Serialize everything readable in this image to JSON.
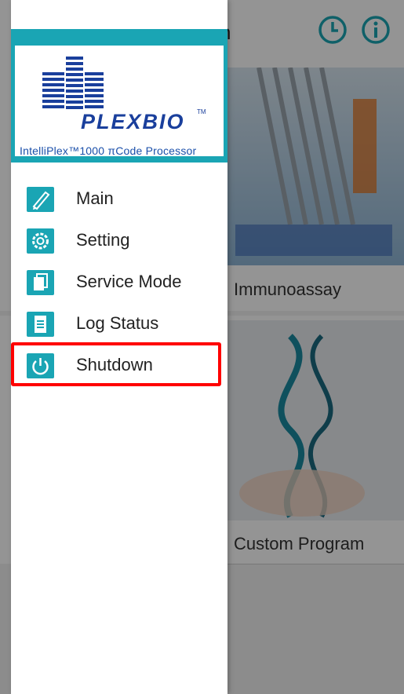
{
  "app": {
    "title": "n",
    "cards": [
      {
        "label": "Immunoassay"
      },
      {
        "label": "Custom Program"
      }
    ]
  },
  "drawer": {
    "logo": {
      "brand": "PLEXBIO",
      "tm": "TM",
      "subtitle": "IntelliPlex™1000 πCode Processor"
    },
    "items": [
      {
        "label": "Main",
        "icon": "pen-icon"
      },
      {
        "label": "Setting",
        "icon": "gear-icon"
      },
      {
        "label": "Service Mode",
        "icon": "copy-icon"
      },
      {
        "label": "Log Status",
        "icon": "document-icon"
      },
      {
        "label": "Shutdown",
        "icon": "power-icon"
      }
    ]
  },
  "colors": {
    "accent": "#1aa5b4",
    "highlight": "#ff0000",
    "brand": "#1a3f9c"
  }
}
